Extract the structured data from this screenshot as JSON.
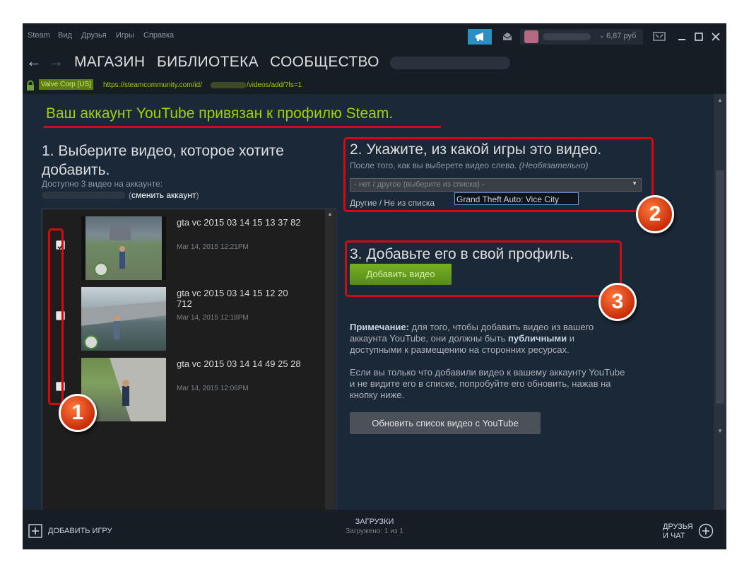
{
  "menu": [
    "Steam",
    "Вид",
    "Друзья",
    "Игры",
    "Справка"
  ],
  "wallet": "6,87 руб",
  "nav": {
    "back_icon": "back-arrow-icon",
    "forward_icon": "forward-arrow-icon",
    "links": [
      "МАГАЗИН",
      "БИБЛИОТЕКА",
      "СООБЩЕСТВО"
    ]
  },
  "url": {
    "cert": "Valve Corp [US]",
    "prefix": "https://steamcommunity.com/id/",
    "suffix": "/videos/add/?ls=1"
  },
  "headline": "Ваш аккаунт YouTube привязан к профилю Steam.",
  "step1": {
    "title": "1. Выберите видео, которое хотите добавить.",
    "available": "Доступно 3 видео на аккаунте:",
    "change_open": "(",
    "change_link": "сменить аккаунт",
    "change_close": ")",
    "videos": [
      {
        "title": "gta vc 2015 03 14 15 13 37 82",
        "date": "Mar 14, 2015 12:21PM",
        "checked": true
      },
      {
        "title": "gta vc 2015 03 14 15 12 20 712",
        "date": "Mar 14, 2015 12:18PM",
        "checked": false
      },
      {
        "title": "gta vc 2015 03 14 14 49 25 28",
        "date": "Mar 14, 2015 12:06PM",
        "checked": false
      }
    ]
  },
  "step2": {
    "title": "2. Укажите, из какой игры это видео.",
    "hint": "После того, как вы выберете видео слева.",
    "hint_optional": "(Необязательно)",
    "select_value": "- нет / другое (выберите из списка) -",
    "other_label": "Другие / Не из списка",
    "other_value": "Grand Theft Auto: Vice City"
  },
  "step3": {
    "title": "3. Добавьте его в свой профиль.",
    "button": "Добавить видео"
  },
  "note": {
    "label": "Примечание:",
    "text1": " для того, чтобы добавить видео из вашего аккаунта YouTube, они должны быть ",
    "bold": "публичными",
    "text2": " и доступными к размещению на сторонних ресурсах.",
    "para2": "Если вы только что добавили видео к вашему аккаунту YouTube и не видите его в списке, попробуйте его обновить, нажав на кнопку ниже."
  },
  "refresh_button": "Обновить список видео с YouTube",
  "bottom": {
    "add_game": "ДОБАВИТЬ ИГРУ",
    "downloads": "ЗАГРУЗКИ",
    "downloads_status": "Загружено: 1 из 1",
    "friends_line1": "ДРУЗЬЯ",
    "friends_line2": "И ЧАТ"
  },
  "badges": [
    "1",
    "2",
    "3"
  ],
  "colors": {
    "accent_green": "#a4d007",
    "annotation_red": "#d20a11",
    "bg": "#1b2838"
  }
}
